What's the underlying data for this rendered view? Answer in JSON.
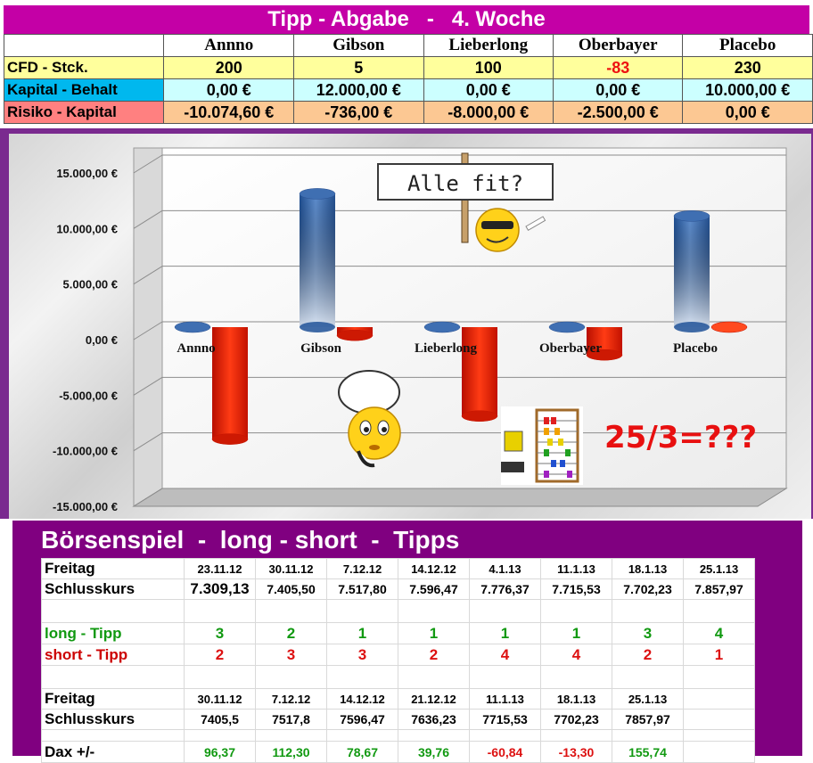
{
  "banner": {
    "title": "Tipp - Abgabe   -   4. Woche"
  },
  "top_table": {
    "headers": [
      "Annno",
      "Gibson",
      "Lieberlong",
      "Oberbayer",
      "Placebo"
    ],
    "rows": [
      {
        "label": "CFD - Stck.",
        "values": [
          "200",
          "5",
          "100",
          "-83",
          "230"
        ]
      },
      {
        "label": "Kapital - Behalt",
        "values": [
          "0,00 €",
          "12.000,00 €",
          "0,00 €",
          "0,00 €",
          "10.000,00 €"
        ]
      },
      {
        "label": "Risiko - Kapital",
        "values": [
          "-10.074,60 €",
          "-736,00 €",
          "-8.000,00 €",
          "-2.500,00 €",
          "0,00 €"
        ]
      }
    ]
  },
  "chart_data": {
    "type": "bar",
    "categories": [
      "Annno",
      "Gibson",
      "Lieberlong",
      "Oberbayer",
      "Placebo"
    ],
    "series": [
      {
        "values": [
          0,
          12000,
          0,
          0,
          10000
        ],
        "color": "#2e5c9e"
      },
      {
        "values": [
          -10074.6,
          -736,
          -8000,
          -2500,
          0
        ],
        "color": "#e21a00"
      }
    ],
    "ylim": [
      -15000,
      15000
    ],
    "yticks": [
      "15.000,00 €",
      "10.000,00 €",
      "5.000,00 €",
      "0,00 €",
      "-5.000,00 €",
      "-10.000,00 €",
      "-15.000,00 €"
    ],
    "grid": true,
    "annotations": {
      "sign": "Alle fit?",
      "formula": "25/3=???"
    }
  },
  "tipps": {
    "title": "Börsenspiel  -  long - short  -  Tipps",
    "block1": {
      "freitag_label": "Freitag",
      "schluss_label": "Schlusskurs",
      "dates": [
        "23.11.12",
        "30.11.12",
        "7.12.12",
        "14.12.12",
        "4.1.13",
        "11.1.13",
        "18.1.13",
        "25.1.13"
      ],
      "prices": [
        "7.309,13",
        "7.405,50",
        "7.517,80",
        "7.596,47",
        "7.776,37",
        "7.715,53",
        "7.702,23",
        "7.857,97"
      ]
    },
    "long_label": "long - Tipp",
    "long_values": [
      "3",
      "2",
      "1",
      "1",
      "1",
      "1",
      "3",
      "4"
    ],
    "short_label": "short - Tipp",
    "short_values": [
      "2",
      "3",
      "3",
      "2",
      "4",
      "4",
      "2",
      "1"
    ],
    "block2": {
      "freitag_label": "Freitag",
      "schluss_label": "Schlusskurs",
      "dates": [
        "30.11.12",
        "7.12.12",
        "14.12.12",
        "21.12.12",
        "11.1.13",
        "18.1.13",
        "25.1.13",
        ""
      ],
      "prices": [
        "7405,5",
        "7517,8",
        "7596,47",
        "7636,23",
        "7715,53",
        "7702,23",
        "7857,97",
        ""
      ]
    },
    "dax_label": "Dax +/-",
    "dax_values": [
      "96,37",
      "112,30",
      "78,67",
      "39,76",
      "-60,84",
      "-13,30",
      "155,74",
      ""
    ]
  }
}
